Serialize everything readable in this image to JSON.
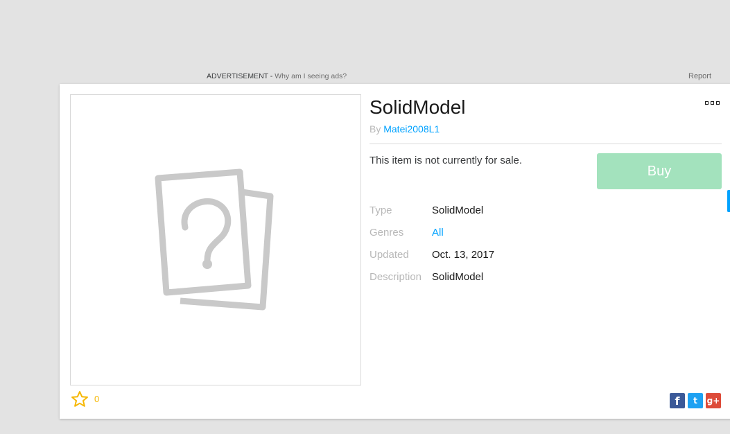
{
  "ad_bar": {
    "label": "ADVERTISEMENT",
    "separator": " - ",
    "why_link": "Why am I seeing ads?",
    "report": "Report"
  },
  "item": {
    "title": "SolidModel",
    "by_prefix": "By ",
    "creator": "Matei2008L1",
    "sale_message": "This item is not currently for sale.",
    "buy_label": "Buy",
    "buy_color": "#a3e2bd",
    "thumbnail_icon": "unknown-image-placeholder-icon"
  },
  "details": [
    {
      "label": "Type",
      "value": "SolidModel",
      "is_link": false
    },
    {
      "label": "Genres",
      "value": "All",
      "is_link": true
    },
    {
      "label": "Updated",
      "value": "Oct. 13, 2017",
      "is_link": false
    },
    {
      "label": "Description",
      "value": "SolidModel",
      "is_link": false
    }
  ],
  "favorite": {
    "icon": "star-outline-icon",
    "count": "0"
  },
  "social": {
    "facebook_glyph": "f",
    "twitter_glyph": "t",
    "googleplus_glyph": "g+"
  },
  "colors": {
    "link": "#00a2ff",
    "star": "#f6b702",
    "facebook": "#3b5998",
    "twitter": "#1da1f2",
    "googleplus": "#dd4b39"
  }
}
